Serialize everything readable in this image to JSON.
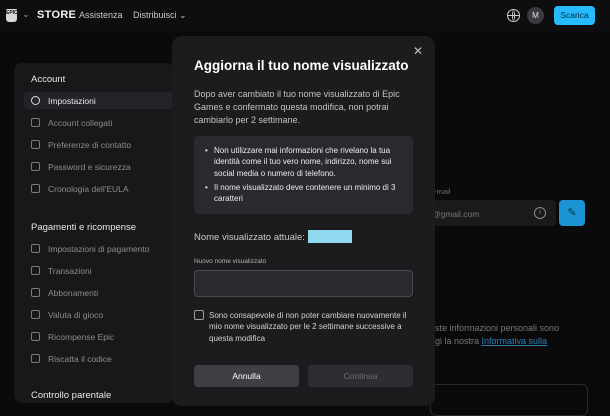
{
  "header": {
    "logo_text": "EPIC",
    "store_label": "STORE",
    "nav": [
      "Assistenza",
      "Distribuisci"
    ],
    "avatar_initial": "M",
    "download_label": "Scarica"
  },
  "sidebar": {
    "account_title": "Account",
    "account_items": [
      {
        "label": "Impostazioni",
        "icon": "user-icon"
      },
      {
        "label": "Account collegati",
        "icon": "link-icon"
      },
      {
        "label": "Preferenze di contatto",
        "icon": "mail-icon"
      },
      {
        "label": "Password e sicurezza",
        "icon": "shield-icon"
      },
      {
        "label": "Cronologia dell'EULA",
        "icon": "document-icon"
      }
    ],
    "payments_title": "Pagamenti e ricompense",
    "payment_items": [
      {
        "label": "Impostazioni di pagamento",
        "icon": "card-icon"
      },
      {
        "label": "Transazioni",
        "icon": "clock-icon"
      },
      {
        "label": "Abbonamenti",
        "icon": "refresh-icon"
      },
      {
        "label": "Valuta di gioco",
        "icon": "coin-icon"
      },
      {
        "label": "Ricompense Epic",
        "icon": "gift-icon"
      },
      {
        "label": "Riscatta il codice",
        "icon": "ticket-icon"
      }
    ],
    "parental_title": "Controllo parentale"
  },
  "background": {
    "email_label": "e-mail",
    "email_value": "@gmail.com",
    "text_line1": "este informazioni personali sono",
    "text_line2_prefix": "ggi la nostra ",
    "text_link": "Informativa sulla"
  },
  "modal": {
    "title": "Aggiorna il tuo nome visualizzato",
    "description": "Dopo aver cambiato il tuo nome visualizzato di Epic Games e confermato questa modifica, non potrai cambiarlo per 2 settimane.",
    "bullets": [
      "Non utilizzare mai informazioni che rivelano la tua identità come il tuo vero nome, indirizzo, nome sui social media o numero di telefono.",
      "Il nome visualizzato deve contenere un minimo di 3 caratteri"
    ],
    "current_label": "Nome visualizzato attuale:",
    "input_label": "Nuovo nome visualizzato",
    "input_value": "",
    "checkbox_text": "Sono consapevole di non poter cambiare nuovamente il mio nome visualizzato per le 2 settimane successive a questa modifica",
    "cancel_label": "Annulla",
    "continue_label": "Continua"
  }
}
